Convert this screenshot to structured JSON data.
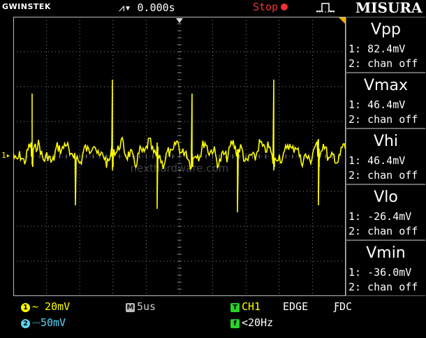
{
  "header": {
    "brand": "GWINSTEK",
    "trigger_readout": "⩘▾ 0.000s",
    "run_status": "Stop",
    "overlay_label": "MISURA"
  },
  "colors": {
    "trace": "#ffff00",
    "grid": "#8a8a8a",
    "stop": "#e33333",
    "ch2": "#5ad8ff",
    "trigger_green": "#2bd12b"
  },
  "measurements": [
    {
      "name": "Vpp",
      "ch1": "1: 82.4mV",
      "ch2": "2: chan off"
    },
    {
      "name": "Vmax",
      "ch1": "1: 46.4mV",
      "ch2": "2: chan off"
    },
    {
      "name": "Vhi",
      "ch1": "1: 46.4mV",
      "ch2": "2: chan off"
    },
    {
      "name": "Vlo",
      "ch1": "1: -26.4mV",
      "ch2": "2: chan off"
    },
    {
      "name": "Vmin",
      "ch1": "1: -36.0mV",
      "ch2": "2: chan off"
    }
  ],
  "status": {
    "ch1_badge": "1",
    "ch1_scale": "~ 20mV",
    "ch2_badge": "2",
    "ch2_scale": "⎓50mV",
    "timebase_badge": "M",
    "timebase": "5us",
    "trigger_badge": "T",
    "trigger_source": "CH1",
    "trigger_type": "EDGE",
    "trigger_coupling": "ƑDC",
    "freq_badge": "f",
    "frequency": "<20Hz"
  },
  "channel_marker": "1▸",
  "watermark": "nexthardware.com"
}
